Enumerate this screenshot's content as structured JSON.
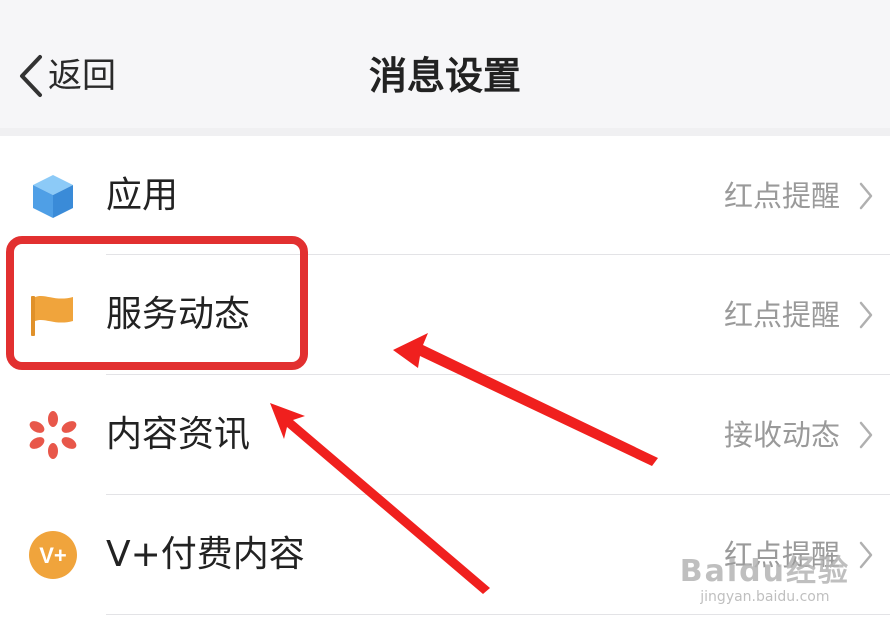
{
  "nav": {
    "back_label": "返回",
    "title": "消息设置"
  },
  "rows": [
    {
      "label": "应用",
      "value": "红点提醒",
      "icon": "cube-icon",
      "icon_color": "#5aaef0"
    },
    {
      "label": "服务动态",
      "value": "红点提醒",
      "icon": "flag-icon",
      "icon_color": "#f0a43c"
    },
    {
      "label": "内容资讯",
      "value": "接收动态",
      "icon": "flower-icon",
      "icon_color": "#e8574a"
    },
    {
      "label": "V+付费内容",
      "value": "红点提醒",
      "icon": "vplus-icon",
      "icon_color": "#f0a43c",
      "icon_text": "V+"
    }
  ],
  "annotation": {
    "highlight_color": "#e23030",
    "arrow_color": "#f0201e"
  },
  "watermark": {
    "brand": "Baidu经验",
    "url": "jingyan.baidu.com"
  }
}
